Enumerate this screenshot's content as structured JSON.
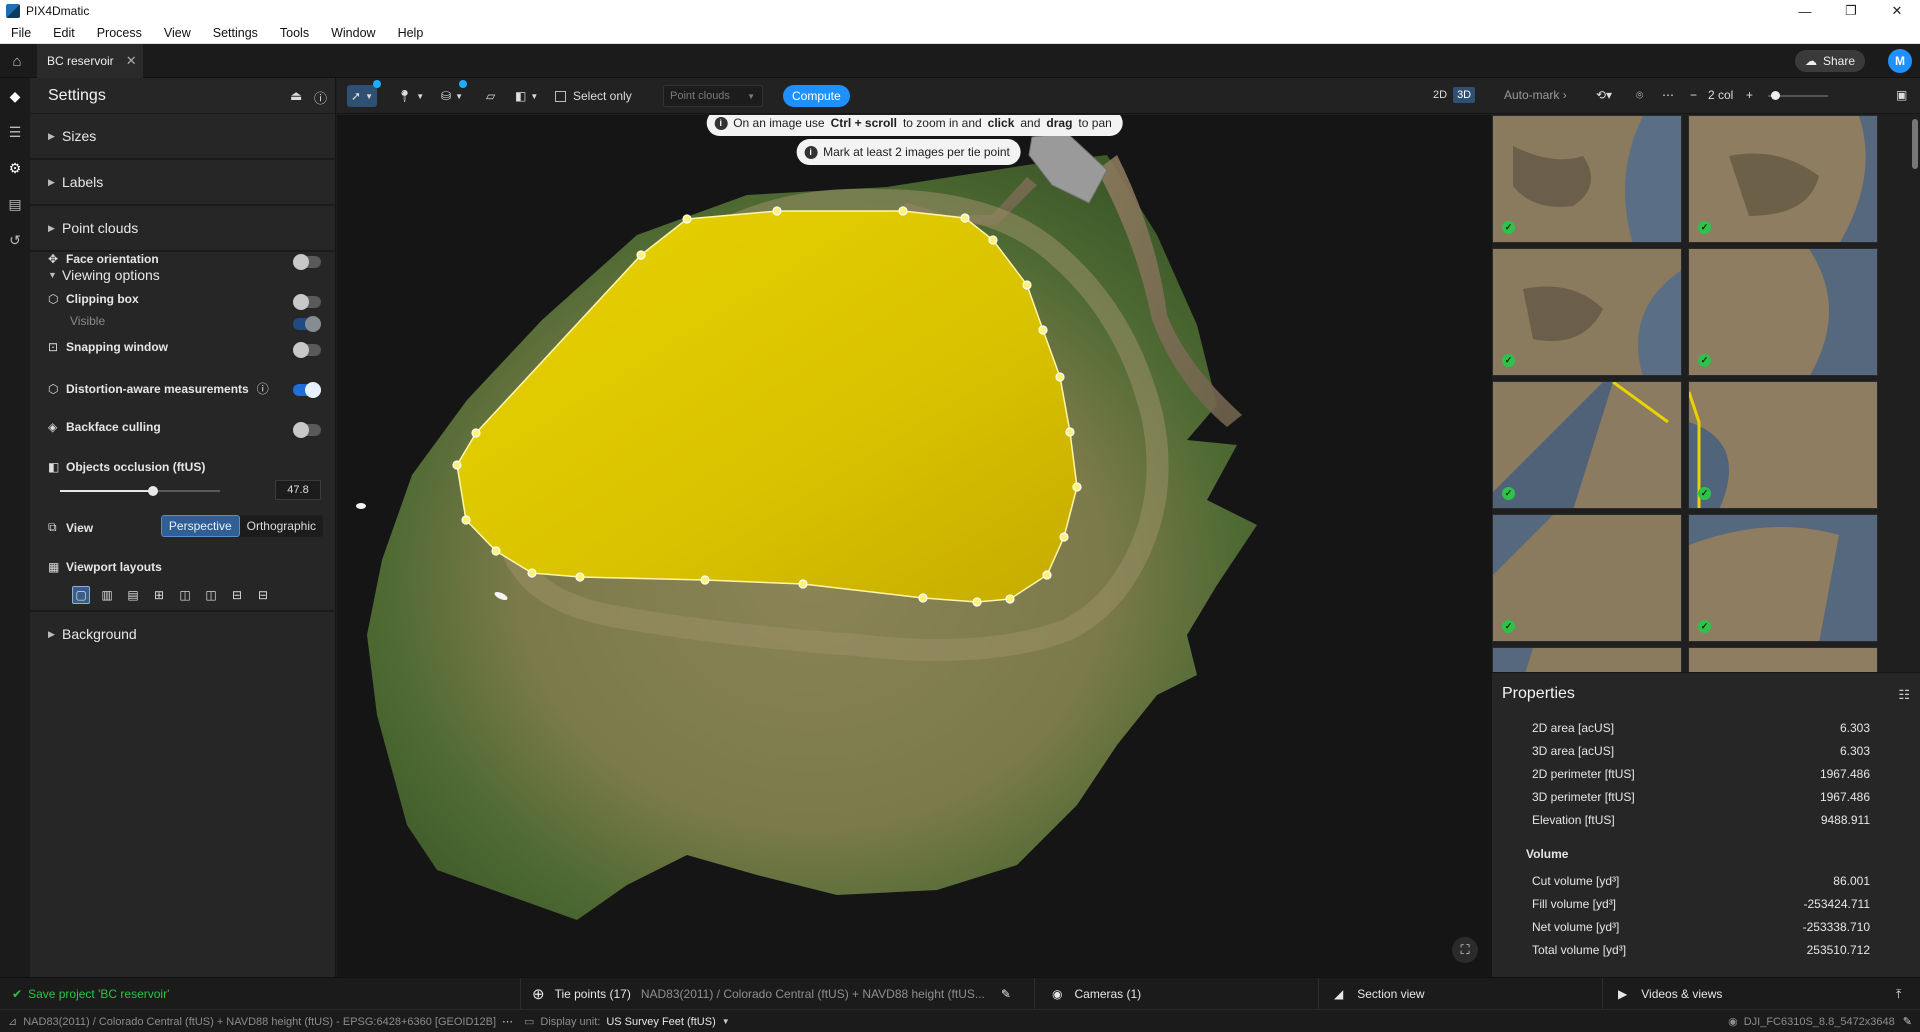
{
  "window": {
    "title": "PIX4Dmatic",
    "controls": [
      "—",
      "❐",
      "✕"
    ]
  },
  "menu": [
    "File",
    "Edit",
    "Process",
    "View",
    "Settings",
    "Tools",
    "Window",
    "Help"
  ],
  "tabs": {
    "project_tab": "BC reservoir",
    "share_label": "Share",
    "avatar_initial": "M"
  },
  "settings": {
    "title": "Settings",
    "collapsed_sections": [
      "Sizes",
      "Labels",
      "Point clouds"
    ],
    "viewing_options_label": "Viewing options",
    "options": {
      "face_orientation": "Face orientation",
      "clipping_box": "Clipping box",
      "visible": "Visible",
      "snapping_window": "Snapping window",
      "distortion_aware": "Distortion-aware measurements",
      "backface_culling": "Backface culling",
      "objects_occlusion": "Objects occlusion (ftUS)",
      "occlusion_value": "47.8",
      "occlusion_fraction": 0.58,
      "view": "View",
      "view_perspective": "Perspective",
      "view_orthographic": "Orthographic",
      "viewport_layouts": "Viewport layouts"
    },
    "toggles": {
      "face_orientation": false,
      "clipping_box": false,
      "visible": true,
      "snapping_window": false,
      "distortion_aware": true,
      "backface_culling": false
    },
    "background_label": "Background"
  },
  "toolbar": {
    "select_only": "Select only",
    "point_clouds_dropdown": "Point clouds",
    "compute": "Compute",
    "mode_2d": "2D",
    "mode_3d": "3D"
  },
  "viewport": {
    "hint_prefix": "On an image use",
    "hint_key1": "Ctrl + scroll",
    "hint_mid1": "to zoom in and",
    "hint_key2": "click",
    "hint_mid2": "and",
    "hint_key3": "drag",
    "hint_suffix": "to pan",
    "hint2": "Mark at least 2 images per tie point"
  },
  "image_panel": {
    "automark": "Auto-mark",
    "columns": "2 col",
    "zoom_fraction": 0.05
  },
  "properties": {
    "title": "Properties",
    "rows": [
      {
        "label": "2D area [acUS]",
        "value": "6.303"
      },
      {
        "label": "3D area [acUS]",
        "value": "6.303"
      },
      {
        "label": "2D perimeter [ftUS]",
        "value": "1967.486"
      },
      {
        "label": "3D perimeter [ftUS]",
        "value": "1967.486"
      },
      {
        "label": "Elevation [ftUS]",
        "value": "9488.911"
      }
    ],
    "volume_header": "Volume",
    "volume_rows": [
      {
        "label": "Cut volume [yd³]",
        "value": "86.001"
      },
      {
        "label": "Fill volume [yd³]",
        "value": "-253424.711"
      },
      {
        "label": "Net volume [yd³]",
        "value": "-253338.710"
      },
      {
        "label": "Total volume [yd³]",
        "value": "253510.712"
      }
    ]
  },
  "bottom": {
    "save_status": "Save project 'BC reservoir'",
    "tie_points": "Tie points (17)",
    "tie_points_crs": "NAD83(2011) / Colorado Central (ftUS) + NAVD88 height (ftUS...",
    "cameras": "Cameras (1)",
    "section_view": "Section view",
    "videos_views": "Videos & views"
  },
  "status": {
    "crs": "NAD83(2011) / Colorado Central (ftUS) + NAVD88 height (ftUS) - EPSG:6428+6360 [GEOID12B]",
    "display_unit_label": "Display unit:",
    "display_unit_value": "US Survey Feet (ftUS)",
    "image_name": "DJI_FC6310S_8.8_5472x3648"
  }
}
